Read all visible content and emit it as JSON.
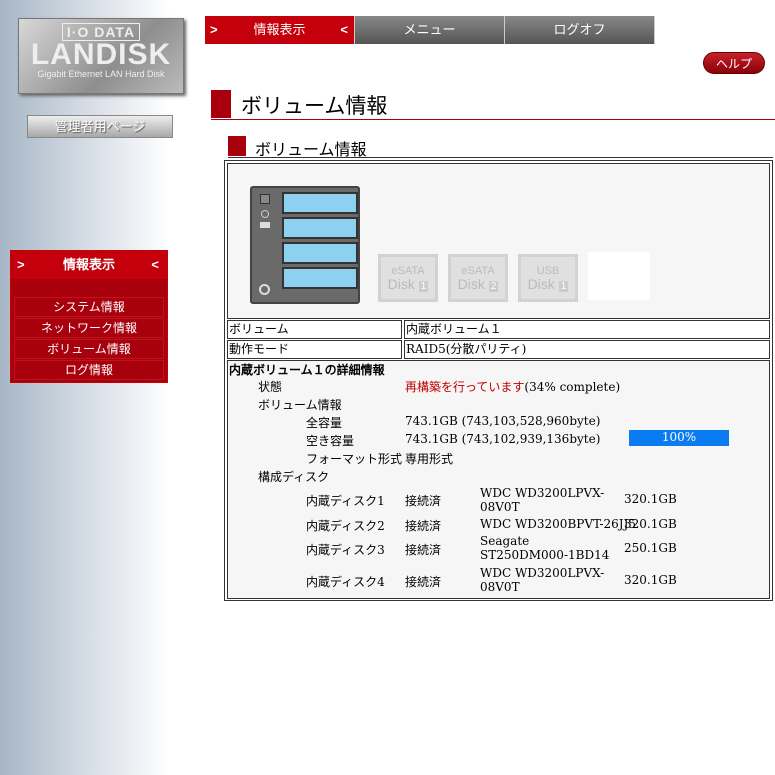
{
  "logo": {
    "brand": "I·O DATA",
    "product": "LANDISK",
    "tagline": "Gigabit Ethernet LAN Hard Disk"
  },
  "admin_button": "管理者用ページ",
  "nav": {
    "tabs": [
      {
        "label": "情報表示",
        "active": true
      },
      {
        "label": "メニュー"
      },
      {
        "label": "ログオフ"
      }
    ],
    "arrow_left": ">",
    "arrow_right": "<"
  },
  "help": "ヘルプ",
  "sidebar": {
    "header": "情報表示",
    "items": [
      {
        "label": "システム情報"
      },
      {
        "label": "ネットワーク情報"
      },
      {
        "label": "ボリューム情報"
      },
      {
        "label": "ログ情報"
      }
    ]
  },
  "page_title": "ボリューム情報",
  "section_title": "ボリューム情報",
  "devices": [
    {
      "line1": "eSATA",
      "line2": "Disk",
      "num": "1"
    },
    {
      "line1": "eSATA",
      "line2": "Disk",
      "num": "2"
    },
    {
      "line1": "USB",
      "line2": "Disk",
      "num": "1"
    }
  ],
  "info": [
    {
      "label": "ボリューム",
      "value": "内蔵ボリューム１"
    },
    {
      "label": "動作モード",
      "value": "RAID5(分散パリティ)"
    }
  ],
  "detail": {
    "header": "内蔵ボリューム１の詳細情報",
    "status_label": "状態",
    "status_value": "再構築を行っています",
    "status_progress": "(34% complete)",
    "volume_label": "ボリューム情報",
    "total_label": "全容量",
    "total_value": "743.1GB (743,103,528,960byte)",
    "free_label": "空き容量",
    "free_value": "743.1GB (743,102,939,136byte)",
    "free_percent_label": "100%",
    "free_percent": 100,
    "format_label": "フォーマット形式",
    "format_value": "専用形式",
    "disks_label": "構成ディスク",
    "disks": [
      {
        "name": "内蔵ディスク1",
        "status": "接続済",
        "model": "WDC WD3200LPVX-08V0T",
        "size": "320.1GB"
      },
      {
        "name": "内蔵ディスク2",
        "status": "接続済",
        "model": "WDC WD3200BPVT-26JJ5",
        "size": "320.1GB"
      },
      {
        "name": "内蔵ディスク3",
        "status": "接続済",
        "model": "Seagate ST250DM000-1BD14",
        "size": "250.1GB"
      },
      {
        "name": "内蔵ディスク4",
        "status": "接続済",
        "model": "WDC WD3200LPVX-08V0T",
        "size": "320.1GB"
      }
    ]
  },
  "colors": {
    "accent": "#a8000c",
    "progress": "#0a7bf0",
    "status": "#c00000"
  }
}
